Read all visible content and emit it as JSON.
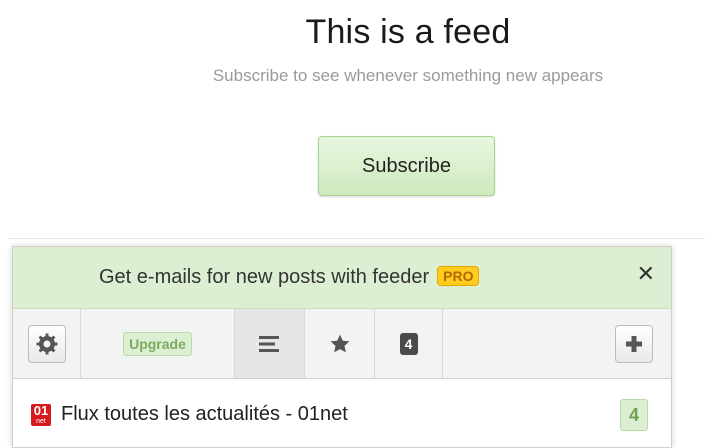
{
  "page": {
    "title": "This is a feed",
    "subtitle": "Subscribe to see whenever something new appears",
    "subscribe_label": "Subscribe"
  },
  "popup": {
    "promo_text": "Get e-mails for new posts with feeder",
    "pro_badge": "PRO",
    "close_label": "✕",
    "toolbar": {
      "upgrade_label": "Upgrade",
      "unread_count": "4"
    },
    "feeds": [
      {
        "logo_text": "01",
        "logo_sub": "net",
        "title": "Flux toutes les actualités - 01net",
        "count": "4"
      }
    ]
  },
  "colors": {
    "accent_green": "#dcefd2",
    "pro_yellow": "#ffcc1f",
    "logo_red": "#d71920"
  },
  "icons": {
    "settings": "gear-icon",
    "list": "list-icon",
    "starred": "star-icon",
    "add": "plus-icon",
    "close": "close-icon"
  }
}
